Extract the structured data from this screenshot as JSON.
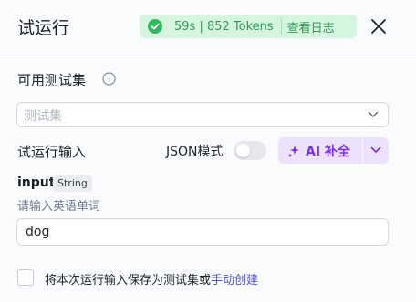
{
  "header": {
    "title": "试运行",
    "status": {
      "text": "59s | 852 Tokens",
      "log_label": "查看日志",
      "color": "#2d9b56"
    },
    "icons": {
      "status": "check-circle-icon",
      "close": "close-icon"
    }
  },
  "test_set": {
    "label": "可用测试集",
    "placeholder": "测试集",
    "icons": {
      "info": "info-icon",
      "dropdown": "chevron-down-icon"
    }
  },
  "run_input": {
    "label": "试运行输入",
    "json_mode_label": "JSON模式",
    "json_mode_on": false,
    "ai_button_label": "AI 补全",
    "ai_accent": "#7c2ef0"
  },
  "fields": [
    {
      "name": "input",
      "type": "String",
      "hint": "请输入英语单词",
      "value": "dog"
    }
  ],
  "footer": {
    "save_text": "将本次运行输入保存为测试集或",
    "create_link": "手动创建",
    "checked": false
  }
}
